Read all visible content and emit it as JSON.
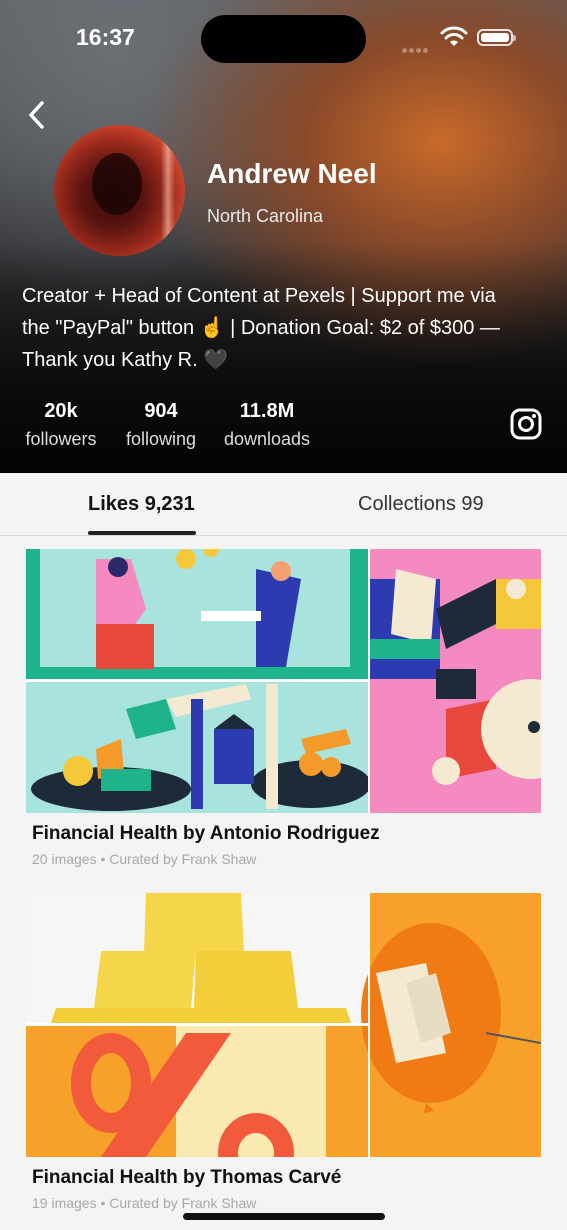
{
  "status_bar": {
    "time": "16:37"
  },
  "profile": {
    "name": "Andrew Neel",
    "location": "North Carolina",
    "bio_lines": [
      "Creator + Head of Content at Pexels  |  Support me via",
      "the \"PayPal\" button ☝️  |  Donation Goal: $2 of $300 —",
      "Thank you Kathy R. 🖤"
    ],
    "stats": [
      {
        "value": "20k",
        "label": "followers"
      },
      {
        "value": "904",
        "label": "following"
      },
      {
        "value": "11.8M",
        "label": "downloads"
      }
    ]
  },
  "tabs": [
    {
      "label": "Likes 9,231",
      "active": true
    },
    {
      "label": "Collections 99",
      "active": false
    }
  ],
  "collections": [
    {
      "title": "Financial Health by Antonio Rodriguez",
      "count": "20 images",
      "curator": "Curated by Frank Shaw"
    },
    {
      "title": "Financial Health by Thomas Carvé",
      "count": "19 images",
      "curator": "Curated by Frank Shaw"
    }
  ],
  "icons": {
    "back": "chevron-left-icon",
    "instagram": "instagram-icon",
    "wifi": "wifi-icon",
    "battery": "battery-icon"
  }
}
